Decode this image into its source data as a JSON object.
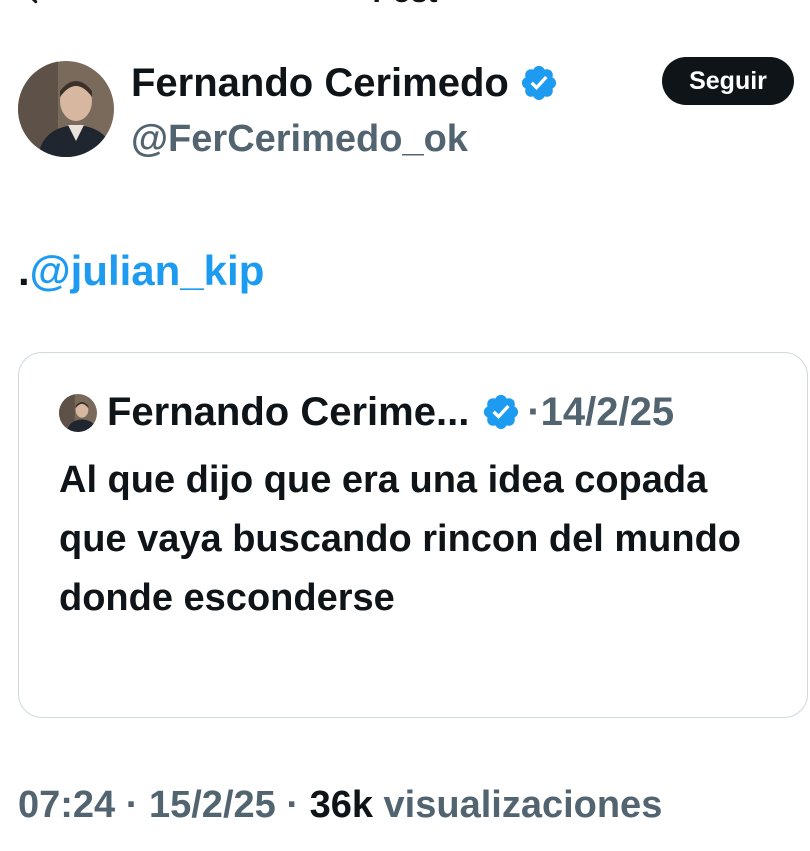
{
  "header": {
    "title": "Post",
    "back_icon": "arrow-left-icon"
  },
  "author": {
    "name": "Fernando Cerimedo",
    "handle": "@FerCerimedo_ok",
    "verified": true,
    "verified_icon": "verified-badge-icon",
    "avatar_icon": "profile-photo"
  },
  "follow_button": {
    "label": "Seguir"
  },
  "tweet": {
    "prefix": ".",
    "mention": "@julian_kip"
  },
  "quote": {
    "author_name": "Fernando Cerime...",
    "separator": "·",
    "date": "14/2/25",
    "text": "Al que dijo que era una idea copada que vaya buscando rincon del mundo donde esconderse"
  },
  "meta": {
    "time": "07:24",
    "separator1": " · ",
    "date": "15/2/25",
    "separator2": " · ",
    "views_count": "36k",
    "views_label": " visualizaciones"
  },
  "colors": {
    "accent": "#1d9bf0",
    "text": "#0f1419",
    "muted": "#536471",
    "border": "#cfd9de"
  }
}
